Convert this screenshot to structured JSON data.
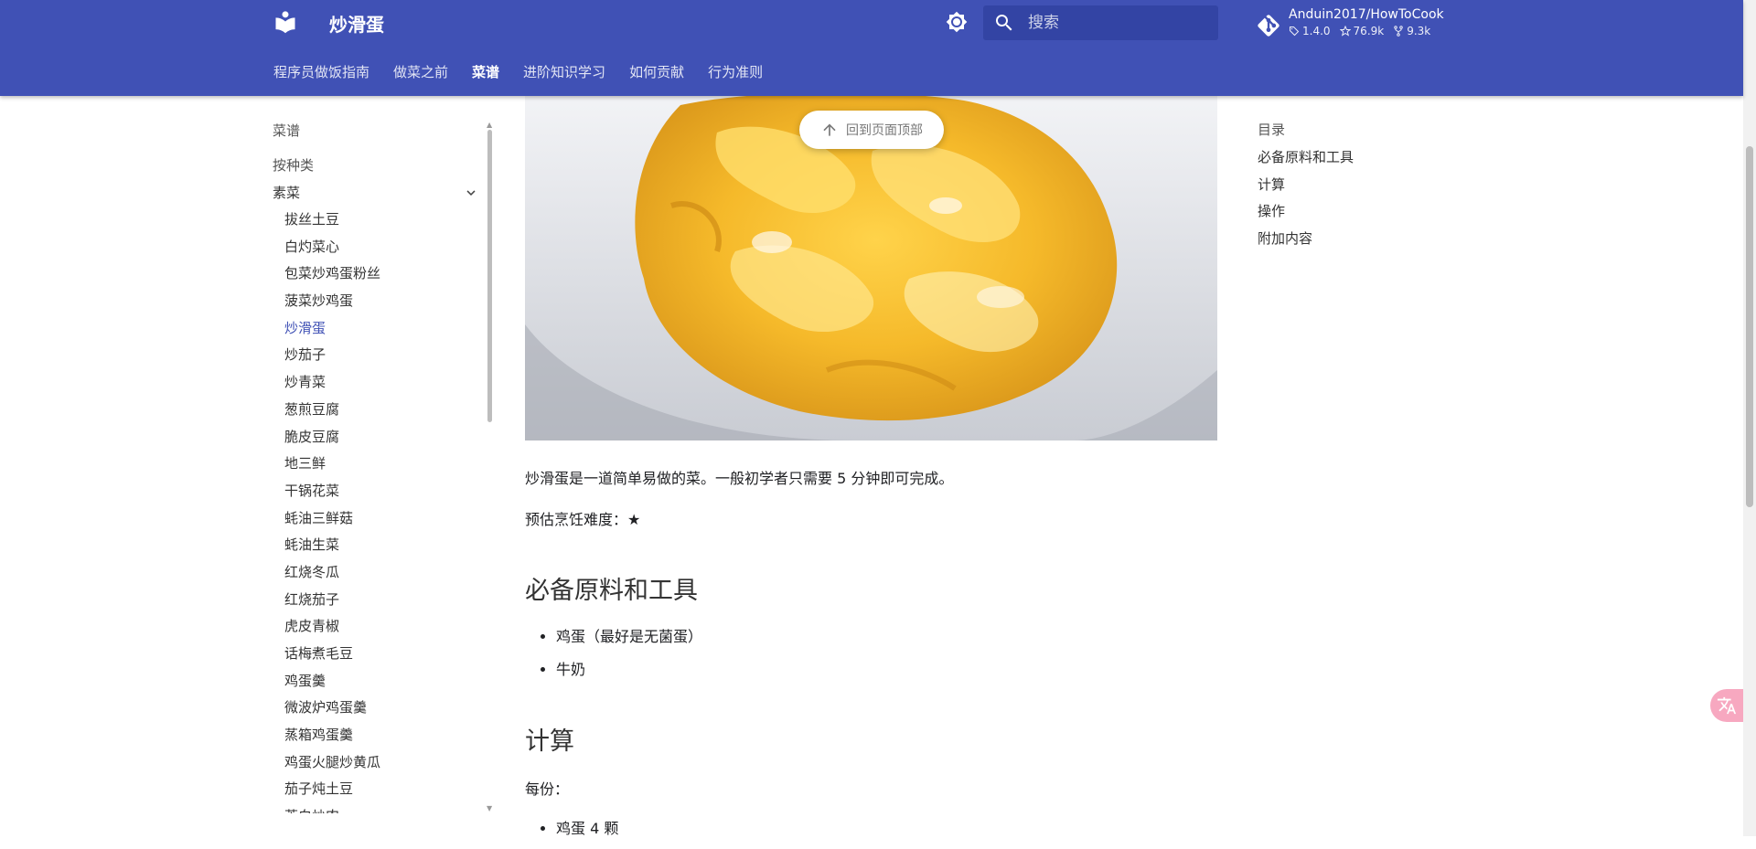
{
  "header": {
    "site_title": "炒滑蛋",
    "search_placeholder": "搜索",
    "repo": {
      "name": "Anduin2017/HowToCook",
      "version": "1.4.0",
      "stars": "76.9k",
      "forks": "9.3k"
    },
    "tabs": [
      {
        "label": "程序员做饭指南"
      },
      {
        "label": "做菜之前"
      },
      {
        "label": "菜谱"
      },
      {
        "label": "进阶知识学习"
      },
      {
        "label": "如何贡献"
      },
      {
        "label": "行为准则"
      }
    ],
    "active_tab": "菜谱",
    "brand_color": "#4051b5"
  },
  "sidebar": {
    "title": "菜谱",
    "section": "按种类",
    "group": "素菜",
    "active_item": "炒滑蛋",
    "items": [
      {
        "label": "拔丝土豆"
      },
      {
        "label": "白灼菜心"
      },
      {
        "label": "包菜炒鸡蛋粉丝"
      },
      {
        "label": "菠菜炒鸡蛋"
      },
      {
        "label": "炒滑蛋"
      },
      {
        "label": "炒茄子"
      },
      {
        "label": "炒青菜"
      },
      {
        "label": "葱煎豆腐"
      },
      {
        "label": "脆皮豆腐"
      },
      {
        "label": "地三鲜"
      },
      {
        "label": "干锅花菜"
      },
      {
        "label": "蚝油三鲜菇"
      },
      {
        "label": "蚝油生菜"
      },
      {
        "label": "红烧冬瓜"
      },
      {
        "label": "红烧茄子"
      },
      {
        "label": "虎皮青椒"
      },
      {
        "label": "话梅煮毛豆"
      },
      {
        "label": "鸡蛋羹"
      },
      {
        "label": "微波炉鸡蛋羹"
      },
      {
        "label": "蒸箱鸡蛋羹"
      },
      {
        "label": "鸡蛋火腿炒黄瓜"
      },
      {
        "label": "茄子炖土豆"
      },
      {
        "label": "茭白炒肉"
      }
    ]
  },
  "content": {
    "back_to_top": "回到页面顶部",
    "intro": "炒滑蛋是一道简单易做的菜。一般初学者只需要 5 分钟即可完成。",
    "difficulty": "预估烹饪难度：★",
    "ingredients_heading": "必备原料和工具",
    "ingredients": [
      {
        "text": "鸡蛋（最好是无菌蛋）"
      },
      {
        "text": "牛奶"
      }
    ],
    "calc_heading": "计算",
    "per_serving": "每份：",
    "calc_items": [
      {
        "text": "鸡蛋 4 颗"
      }
    ]
  },
  "toc": {
    "title": "目录",
    "items": [
      {
        "label": "必备原料和工具"
      },
      {
        "label": "计算"
      },
      {
        "label": "操作"
      },
      {
        "label": "附加内容"
      }
    ]
  }
}
